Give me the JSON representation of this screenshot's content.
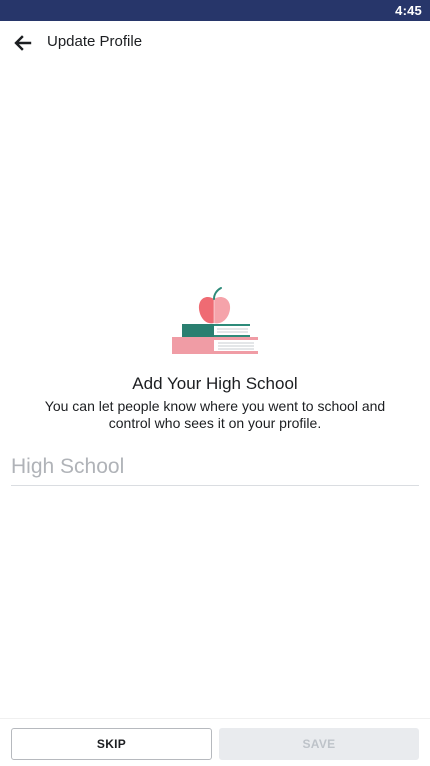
{
  "status_bar": {
    "time": "4:45",
    "color": "#27366a"
  },
  "header": {
    "back_icon": "arrow-left-icon",
    "title": "Update Profile"
  },
  "illustration": {
    "icon": "apple-on-books-icon"
  },
  "content": {
    "heading": "Add Your High School",
    "description": "You can let people know where you went to school and control who sees it on your profile."
  },
  "form": {
    "school_value": "",
    "school_placeholder": "High School"
  },
  "footer": {
    "skip_label": "SKIP",
    "save_label": "SAVE"
  }
}
